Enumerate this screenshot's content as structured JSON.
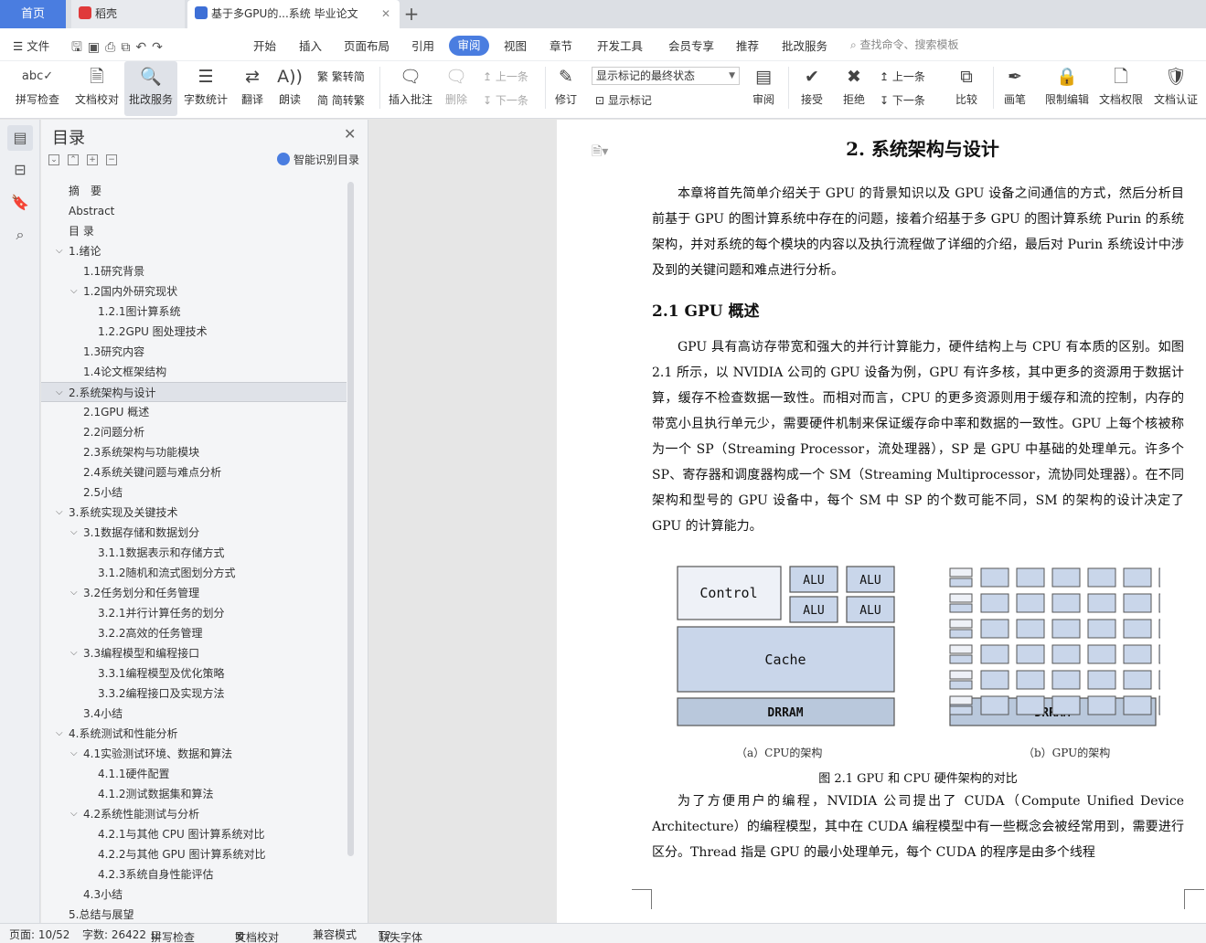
{
  "tabs": {
    "home": "首页",
    "daoke": "稻壳",
    "doc": "基于多GPU的...系统 毕业论文",
    "plus": "+"
  },
  "menu": {
    "file": "文件",
    "items": [
      "开始",
      "插入",
      "页面布局",
      "引用",
      "审阅",
      "视图",
      "章节",
      "开发工具",
      "会员专享",
      "推荐",
      "批改服务"
    ],
    "active": "审阅",
    "search_placeholder": "查找命令、搜索模板"
  },
  "ribbon": {
    "spell": "拼写检查",
    "doc_check": "文档校对",
    "revise_service": "批改服务",
    "word_count": "字数统计",
    "translate": "翻译",
    "read_aloud": "朗读",
    "trad": "繁转简",
    "simp": "简转繁",
    "insert_comment": "插入批注",
    "delete": "删除",
    "prev": "上一条",
    "next": "下一条",
    "track": "修订",
    "markup_select": "显示标记的最终状态",
    "show_markup": "显示标记",
    "review": "审阅",
    "accept": "接受",
    "reject": "拒绝",
    "prev2": "上一条",
    "next2": "下一条",
    "compare": "比较",
    "pen": "画笔",
    "restrict": "限制编辑",
    "permission": "文档权限",
    "certify": "文档认证"
  },
  "toc": {
    "title": "目录",
    "smart": "智能识别目录",
    "items": [
      {
        "label": "摘　要",
        "level": 0
      },
      {
        "label": "Abstract",
        "level": 0
      },
      {
        "label": "目 录",
        "level": 0
      },
      {
        "label": "1.绪论",
        "level": 0,
        "expanded": true
      },
      {
        "label": "1.1研究背景",
        "level": 1
      },
      {
        "label": "1.2国内外研究现状",
        "level": 1,
        "expanded": true
      },
      {
        "label": "1.2.1图计算系统",
        "level": 2
      },
      {
        "label": "1.2.2GPU 图处理技术",
        "level": 2
      },
      {
        "label": "1.3研究内容",
        "level": 1
      },
      {
        "label": "1.4论文框架结构",
        "level": 1
      },
      {
        "label": "2.系统架构与设计",
        "level": 0,
        "expanded": true,
        "selected": true
      },
      {
        "label": "2.1GPU 概述",
        "level": 1
      },
      {
        "label": "2.2问题分析",
        "level": 1
      },
      {
        "label": "2.3系统架构与功能模块",
        "level": 1
      },
      {
        "label": "2.4系统关键问题与难点分析",
        "level": 1
      },
      {
        "label": "2.5小结",
        "level": 1
      },
      {
        "label": "3.系统实现及关键技术",
        "level": 0,
        "expanded": true
      },
      {
        "label": "3.1数据存储和数据划分",
        "level": 1,
        "expanded": true
      },
      {
        "label": "3.1.1数据表示和存储方式",
        "level": 2
      },
      {
        "label": "3.1.2随机和流式图划分方式",
        "level": 2
      },
      {
        "label": "3.2任务划分和任务管理",
        "level": 1,
        "expanded": true
      },
      {
        "label": "3.2.1并行计算任务的划分",
        "level": 2
      },
      {
        "label": "3.2.2高效的任务管理",
        "level": 2
      },
      {
        "label": "3.3编程模型和编程接口",
        "level": 1,
        "expanded": true
      },
      {
        "label": "3.3.1编程模型及优化策略",
        "level": 2
      },
      {
        "label": "3.3.2编程接口及实现方法",
        "level": 2
      },
      {
        "label": "3.4小结",
        "level": 1
      },
      {
        "label": "4.系统测试和性能分析",
        "level": 0,
        "expanded": true
      },
      {
        "label": "4.1实验测试环境、数据和算法",
        "level": 1,
        "expanded": true
      },
      {
        "label": "4.1.1硬件配置",
        "level": 2
      },
      {
        "label": "4.1.2测试数据集和算法",
        "level": 2
      },
      {
        "label": "4.2系统性能测试与分析",
        "level": 1,
        "expanded": true
      },
      {
        "label": "4.2.1与其他 CPU 图计算系统对比",
        "level": 2
      },
      {
        "label": "4.2.2与其他 GPU 图计算系统对比",
        "level": 2
      },
      {
        "label": "4.2.3系统自身性能评估",
        "level": 2
      },
      {
        "label": "4.3小结",
        "level": 1
      },
      {
        "label": "5.总结与展望",
        "level": 0
      }
    ]
  },
  "doc": {
    "h1": "2.  系统架构与设计",
    "p1": "本章将首先简单介绍关于 GPU 的背景知识以及 GPU 设备之间通信的方式，然后分析目前基于 GPU 的图计算系统中存在的问题，接着介绍基于多 GPU 的图计算系统 Purin 的系统架构，并对系统的每个模块的内容以及执行流程做了详细的介绍，最后对 Purin 系统设计中涉及到的关键问题和难点进行分析。",
    "h2": "2.1 GPU 概述",
    "p2": "GPU 具有高访存带宽和强大的并行计算能力，硬件结构上与 CPU 有本质的区别。如图 2.1 所示，以 NVIDIA 公司的 GPU 设备为例，GPU 有许多核，其中更多的资源用于数据计算，缓存不检查数据一致性。而相对而言，CPU 的更多资源则用于缓存和流的控制，内存的带宽小且执行单元少，需要硬件机制来保证缓存命中率和数据的一致性。GPU 上每个核被称为一个 SP（Streaming Processor，流处理器），SP 是 GPU 中基础的处理单元。许多个 SP、寄存器和调度器构成一个 SM（Streaming Multiprocessor，流协同处理器）。在不同架构和型号的 GPU 设备中，每个 SM 中 SP 的个数可能不同，SM 的架构的设计决定了 GPU 的计算能力。",
    "fig": {
      "control": "Control",
      "alu": "ALU",
      "cache": "Cache",
      "dram": "DRRAM",
      "cap_a": "（a）CPU的架构",
      "cap_b": "（b）GPU的架构"
    },
    "fig_caption": "图 2.1 GPU 和 CPU 硬件架构的对比",
    "p3": "为了方便用户的编程，NVIDIA 公司提出了 CUDA（Compute Unified Device Architecture）的编程模型，其中在 CUDA 编程模型中有一些概念会被经常用到，需要进行区分。Thread 指是 GPU 的最小处理单元，每个 CUDA 的程序是由多个线程"
  },
  "status": {
    "page": "页面: 10/52",
    "words": "字数: 26422",
    "spell": "拼写检查",
    "check": "文档校对",
    "compat": "兼容模式",
    "missing_font": "缺失字体"
  }
}
